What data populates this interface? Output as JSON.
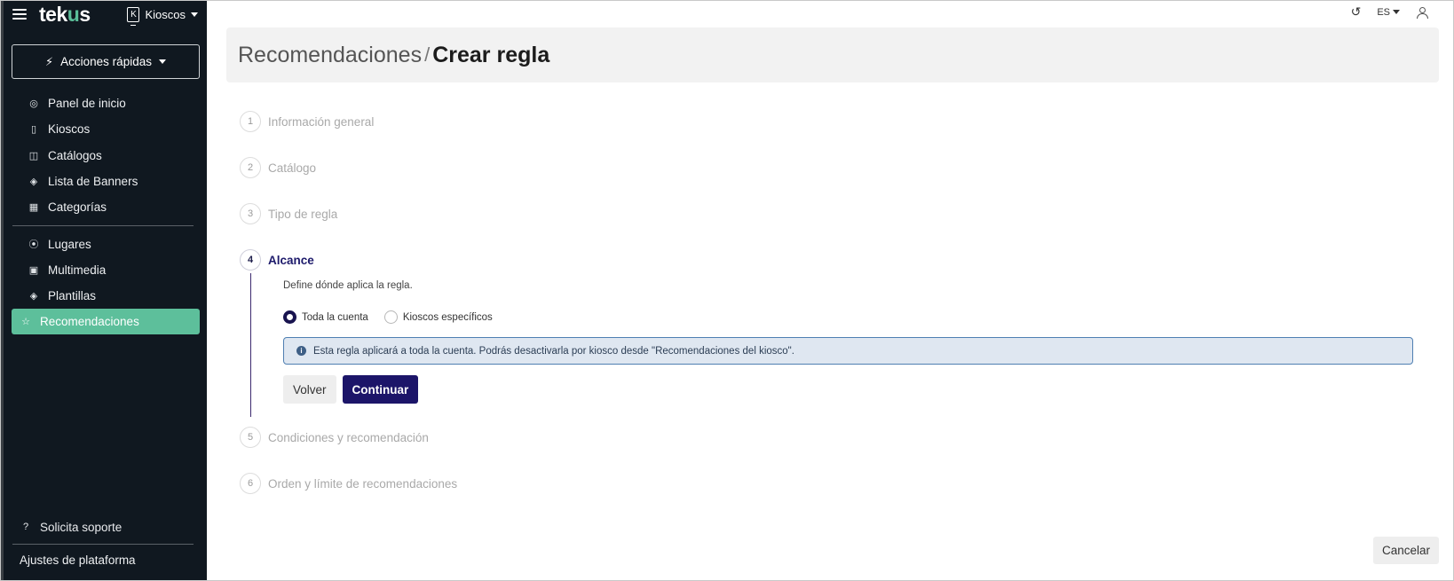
{
  "brand": {
    "logo_pre": "tek",
    "logo_u": "u",
    "logo_post": "s"
  },
  "kiosk_switch": {
    "icon_letter": "K",
    "label": "Kioscos"
  },
  "quick_actions": {
    "label": "Acciones rápidas"
  },
  "sidebar": {
    "group1": [
      {
        "label": "Panel de inicio",
        "icon": "dashboard-icon"
      },
      {
        "label": "Kioscos",
        "icon": "kiosk-icon"
      },
      {
        "label": "Catálogos",
        "icon": "book-icon"
      },
      {
        "label": "Lista de Banners",
        "icon": "layers-icon"
      },
      {
        "label": "Categorías",
        "icon": "categories-icon"
      }
    ],
    "group2": [
      {
        "label": "Lugares",
        "icon": "location-pin-icon"
      },
      {
        "label": "Multimedia",
        "icon": "image-icon"
      },
      {
        "label": "Plantillas",
        "icon": "layers-icon"
      },
      {
        "label": "Recomendaciones",
        "icon": "star-icon",
        "active": true
      }
    ],
    "support": "Solicita soporte",
    "settings": "Ajustes de plataforma"
  },
  "topbar": {
    "language": "ES"
  },
  "header": {
    "breadcrumb": "Recomendaciones",
    "separator": "/",
    "current": "Crear regla"
  },
  "steps": [
    {
      "num": "1",
      "label": "Información general"
    },
    {
      "num": "2",
      "label": "Catálogo"
    },
    {
      "num": "3",
      "label": "Tipo de regla"
    },
    {
      "num": "4",
      "label": "Alcance"
    },
    {
      "num": "5",
      "label": "Condiciones y recomendación"
    },
    {
      "num": "6",
      "label": "Orden y límite de recomendaciones"
    }
  ],
  "scope": {
    "description": "Define dónde aplica la regla.",
    "option_all": "Toda la cuenta",
    "option_specific": "Kioscos específicos",
    "selected": "Toda la cuenta",
    "info": "Esta regla aplicará a toda la cuenta. Podrás desactivarla por kiosco desde \"Recomendaciones del kiosco\".",
    "back": "Volver",
    "continue": "Continuar"
  },
  "cancel": "Cancelar",
  "colors": {
    "sidebar_bg": "#101820",
    "active_item": "#5dbf9b",
    "primary": "#1c1569",
    "info_bg": "#dfe7f1"
  }
}
